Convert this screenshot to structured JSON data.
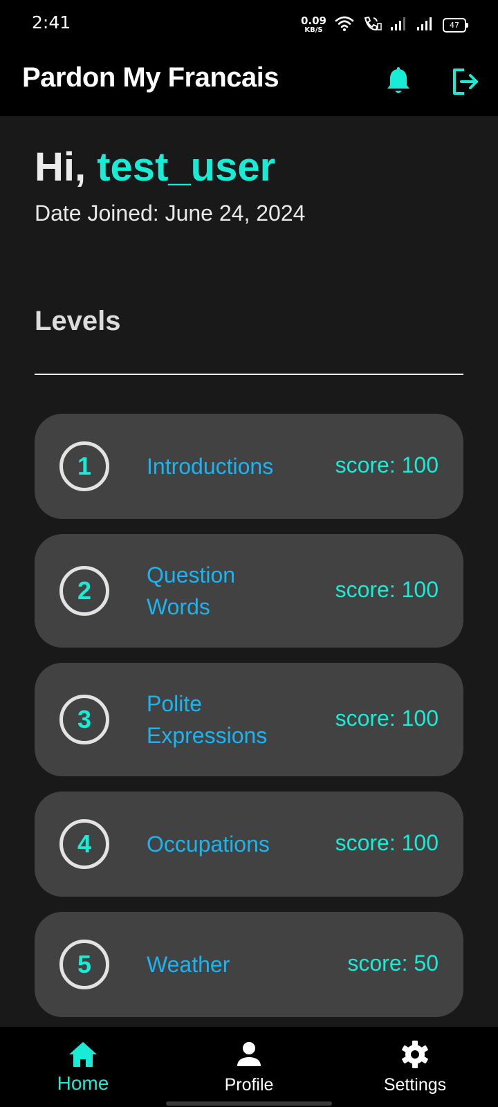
{
  "status_bar": {
    "time": "2:41",
    "net_speed_value": "0.09",
    "net_speed_unit": "KB/S",
    "battery": "47",
    "icons": [
      "wifi-icon",
      "call-icon",
      "signal-icon",
      "signal-icon"
    ]
  },
  "app_bar": {
    "title": "Pardon My Francais",
    "actions": [
      {
        "icon": "bell-icon",
        "color": "#18ebd6"
      },
      {
        "icon": "logout-icon",
        "color": "#18ebd6"
      }
    ]
  },
  "greeting": {
    "prefix": "Hi, ",
    "username": "test_user",
    "date_joined": "Date Joined: June 24, 2024"
  },
  "levels": {
    "heading": "Levels",
    "items": [
      {
        "number": "1",
        "name": "Introductions",
        "score": "score: 100"
      },
      {
        "number": "2",
        "name": "Question Words",
        "score": "score: 100"
      },
      {
        "number": "3",
        "name": "Polite Expressions",
        "score": "score: 100"
      },
      {
        "number": "4",
        "name": "Occupations",
        "score": "score: 100"
      },
      {
        "number": "5",
        "name": "Weather",
        "score": "score: 50"
      }
    ]
  },
  "bottom_nav": {
    "items": [
      {
        "label": "Home",
        "icon": "home-icon",
        "active": true
      },
      {
        "label": "Profile",
        "icon": "person-icon",
        "active": false
      },
      {
        "label": "Settings",
        "icon": "gear-icon",
        "active": false
      }
    ]
  },
  "colors": {
    "accent": "#18ebd6",
    "level_name": "#1ab5f0",
    "card_background": "#424242",
    "page_background": "#191919",
    "bar_background": "#000000"
  }
}
